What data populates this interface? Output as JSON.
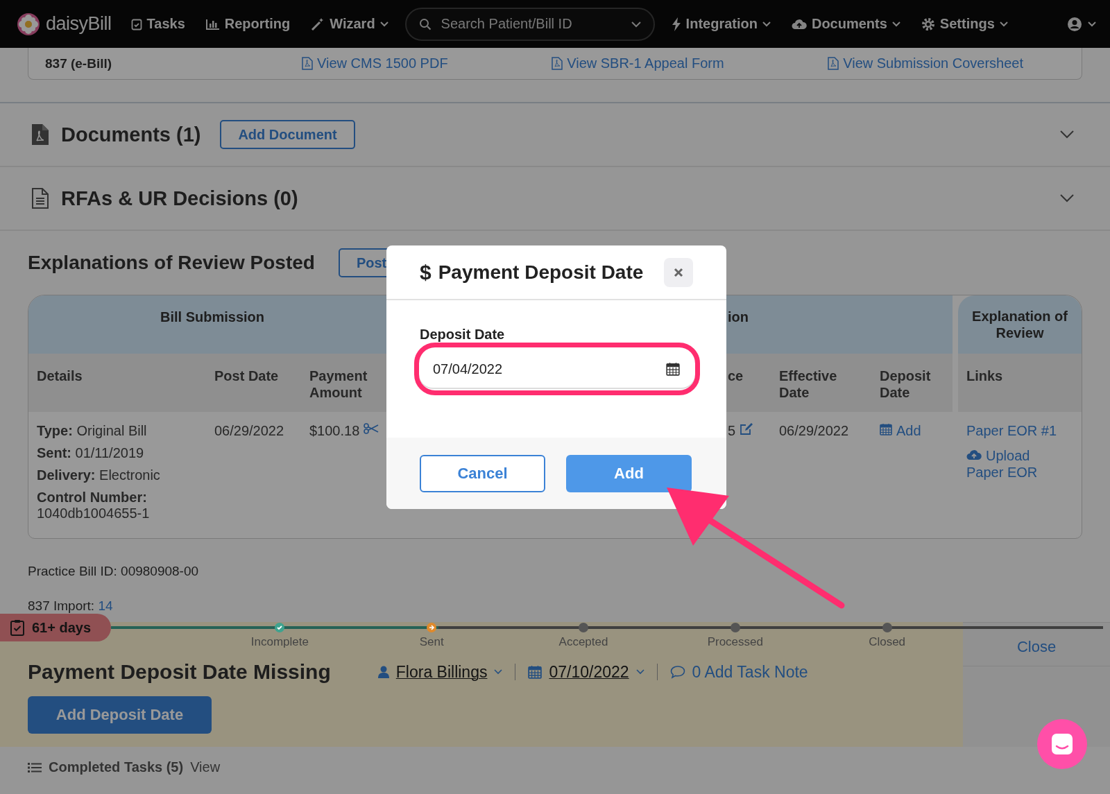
{
  "nav": {
    "logo": "daisyBill",
    "left_items": [
      {
        "label": "Tasks",
        "dropdown": false
      },
      {
        "label": "Reporting",
        "dropdown": false
      },
      {
        "label": "Wizard",
        "dropdown": true
      }
    ],
    "search": {
      "placeholder": "Search Patient/Bill ID"
    },
    "right_items": [
      {
        "label": "Integration",
        "dropdown": true
      },
      {
        "label": "Documents",
        "dropdown": true
      },
      {
        "label": "Settings",
        "dropdown": true
      }
    ]
  },
  "bill_row": {
    "format": "837 (e-Bill)",
    "links": [
      "View CMS 1500 PDF",
      "View SBR-1 Appeal Form",
      "View Submission Coversheet"
    ]
  },
  "sections": [
    {
      "title": "Documents (1)",
      "button": "Add Document"
    },
    {
      "title": "RFAs & UR Decisions (0)"
    }
  ],
  "eor": {
    "title": "Explanations of Review Posted",
    "button": "Post",
    "groups": [
      "Bill Submission",
      "ion",
      "Explanation of Review"
    ],
    "columns": [
      "Details",
      "Post Date",
      "Payment Amount",
      "ce",
      "Effective Date",
      "Deposit Date",
      "Links"
    ],
    "row": {
      "details": [
        "**Type:** Original Bill",
        "**Sent:** 01/11/2019",
        "**Delivery:** Electronic",
        "**Control Number:** 1040db1004655-1"
      ],
      "post_date": "06/29/2022",
      "payment": "$100.18",
      "col_ce": "5",
      "effective_date": "06/29/2022",
      "deposit": "Add",
      "links": [
        "Paper EOR #1"
      ],
      "upload": "Upload Paper EOR"
    }
  },
  "practice_bill_id": "Practice Bill ID: 00980908-00",
  "import": {
    "label": "837 Import:",
    "link": "14"
  },
  "task": {
    "badge": "61+ days",
    "steps": [
      {
        "label": "Incomplete",
        "completed": true,
        "current": false
      },
      {
        "label": "Sent",
        "completed": false,
        "current": true
      },
      {
        "label": "Accepted",
        "completed": false,
        "current": false
      },
      {
        "label": "Processed",
        "completed": false,
        "current": false
      },
      {
        "label": "Closed",
        "completed": false,
        "current": false
      }
    ],
    "title": "Payment Deposit Date Missing",
    "assignee": "Flora Billings",
    "due": "07/10/2022",
    "note": "0 Add Task Note",
    "button": "Add Deposit Date",
    "close": "Close"
  },
  "completed": {
    "label": "Completed Tasks (5)",
    "link": "View"
  },
  "modal": {
    "symbol": "$",
    "title": "Payment Deposit Date",
    "field_label": "Deposit Date",
    "value": "07/04/2022",
    "cancel": "Cancel",
    "confirm": "Add"
  }
}
